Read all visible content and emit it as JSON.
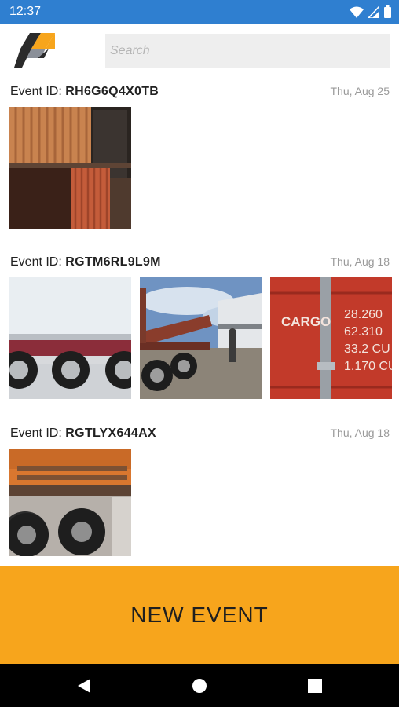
{
  "status_bar": {
    "time": "12:37"
  },
  "search": {
    "placeholder": "Search"
  },
  "events": [
    {
      "id_label": "Event ID:",
      "id": "RH6G6Q4X0TB",
      "date": "Thu, Aug 25",
      "photos": [
        "shipping-containers-photo"
      ]
    },
    {
      "id_label": "Event ID:",
      "id": "RGTM6RL9L9M",
      "date": "Thu, Aug 18",
      "photos": [
        "trailer-wheels-photo",
        "flatbed-truck-photo",
        "cargo-container-photo"
      ]
    },
    {
      "id_label": "Event ID:",
      "id": "RGTLYX644AX",
      "date": "Thu, Aug 18",
      "photos": [
        "orange-truck-wheels-photo"
      ]
    }
  ],
  "cargo_photo_text": {
    "cargo": "CARGO",
    "line1": "28.260",
    "line2": "62.310",
    "line3": "33.2  CU",
    "line4": "1.170 CU"
  },
  "new_event_button": {
    "label": "NEW EVENT"
  },
  "colors": {
    "status_bar": "#2f7fd0",
    "accent": "#f7a51c",
    "nav_bar": "#000000"
  },
  "icons": [
    "wifi-icon",
    "signal-icon",
    "battery-icon",
    "app-logo",
    "back-icon",
    "home-icon",
    "recents-icon"
  ]
}
